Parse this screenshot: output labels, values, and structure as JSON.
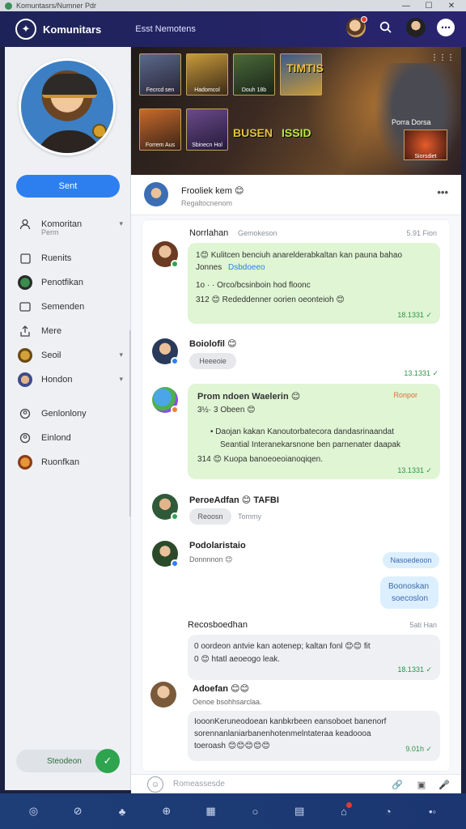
{
  "os": {
    "title": "Komuntasrs/Numner Pdr",
    "controls": [
      "—",
      "☐",
      "✕"
    ]
  },
  "header": {
    "title": "Komunitars",
    "subtitle": "Esst Nemotens",
    "logo_glyph": "✦"
  },
  "sidebar": {
    "send_label": "Sent",
    "items": [
      {
        "label": "Komoritan",
        "sub": "Perm",
        "icon": "person-icon",
        "has_chevron": true
      },
      {
        "label": "Ruenits",
        "icon": "square-icon"
      },
      {
        "label": "Penotfikan",
        "icon": "avatar-icon"
      },
      {
        "label": "Semenden",
        "icon": "rectangle-icon"
      },
      {
        "label": "Mere",
        "icon": "upload-icon"
      },
      {
        "label": "Seoil",
        "icon": "avatar-icon",
        "has_chevron": true
      },
      {
        "label": "Hondon",
        "icon": "avatar-icon",
        "has_chevron": true
      },
      {
        "label": "Genlonlony",
        "icon": "users-icon"
      },
      {
        "label": "Einlond",
        "icon": "users-icon"
      },
      {
        "label": "Ruonfkan",
        "icon": "avatar-icon"
      }
    ],
    "status_label": "Steodeon",
    "status_icon": "✓"
  },
  "banner": {
    "tiles": [
      "Fecrcd sen",
      "Hadomcol",
      "Douh 18b",
      "",
      "Forrem Aus",
      "Sbinecn Hol",
      "Sba eeo"
    ],
    "big_texts": [
      "TIMTIS",
      "BUSEN",
      "ISSID"
    ],
    "label": "Porra Dorsa",
    "thumb_caption": "Siorsdiet",
    "more": "⋮⋮⋮"
  },
  "post": {
    "title": "Frooliek kem 😊",
    "subtitle": "Regaltocnenom",
    "more": "•••"
  },
  "thread": {
    "header_name": "Norrlahan",
    "header_tag": "Gemokeson",
    "header_time": "5.91 Fion",
    "msg1": {
      "line1": "1😊 Kulitcen benciuh anarelderabkaltan kan pauna bahao",
      "line2_plain": "Jonnes",
      "line2_link": "Dsbdoeeo",
      "line3": "1o  · ·  Orco/bcsinboin hod floonc",
      "line4": "312 😊 Rededdenner oorien oeonteioh 😊",
      "time": "18.1331 ✓"
    },
    "msg2": {
      "name": "Boiolofil 😊",
      "chip": "Heeeoie",
      "time": "13.1331 ✓"
    },
    "msg3": {
      "title": "Prom ndoen Waelerin 😊",
      "tag": "Ronpor",
      "line1": "3½·  3 Obeen 😊",
      "bullet1": "•  Daojan kakan Kanoutorbatecora dandasrinaandat",
      "bullet2": "Seantial Interanekarsnone ben parnenater daapak",
      "line4": "314 😊 Kuopa banoeoeoianoqiqen.",
      "time": "13.1331 ✓"
    },
    "msg4": {
      "name": "PeroeAdfan 😊 TAFBI",
      "chip": "Reoosn",
      "note": "Tommy"
    },
    "msg5": {
      "name": "Podolaristaio",
      "sub": "Donnnnon 😊",
      "right_chip": "Nasoedeoon",
      "right_bubble_1": "Boonoskan",
      "right_bubble_2": "soecoslon"
    },
    "msg6": {
      "name": "Recosboedhan",
      "time": "5ati Han",
      "line1": "0 oordeon antvie kan aotenep; kaltan fonl 😊😊 fit",
      "line2": "0 😊 htatl aeoeogo leak.",
      "stamp": "18.1331 ✓"
    },
    "msg7": {
      "name": "Adoefan 😊😊",
      "sub": "Oenoe bsohhsarclaa.",
      "line1": "IooonKeruneodoean kanbkrbeen eansoboet banenorf",
      "line2": "sorennanlaniarbanenhotenmelntateraa keadoooa",
      "line3": "toeroash 😊😊😊😊😊",
      "time": "9.01h ✓"
    }
  },
  "composer": {
    "placeholder": "Romeassesde",
    "emoji_glyph": "☺",
    "attach_glyph": "🔗",
    "image_glyph": "▣",
    "mic_glyph": "🎤"
  },
  "bottom_nav": [
    {
      "name": "home-icon",
      "glyph": "◎"
    },
    {
      "name": "compass-icon",
      "glyph": "⊘"
    },
    {
      "name": "groups-icon",
      "glyph": "♣"
    },
    {
      "name": "globe-icon",
      "glyph": "⊕"
    },
    {
      "name": "calendar-icon",
      "glyph": "▦"
    },
    {
      "name": "chat-icon",
      "glyph": "○"
    },
    {
      "name": "book-icon",
      "glyph": "▤"
    },
    {
      "name": "notification-icon",
      "glyph": "⌂",
      "badge": true
    },
    {
      "name": "headset-icon",
      "glyph": "◔"
    },
    {
      "name": "more-icon",
      "glyph": "•◦"
    }
  ]
}
